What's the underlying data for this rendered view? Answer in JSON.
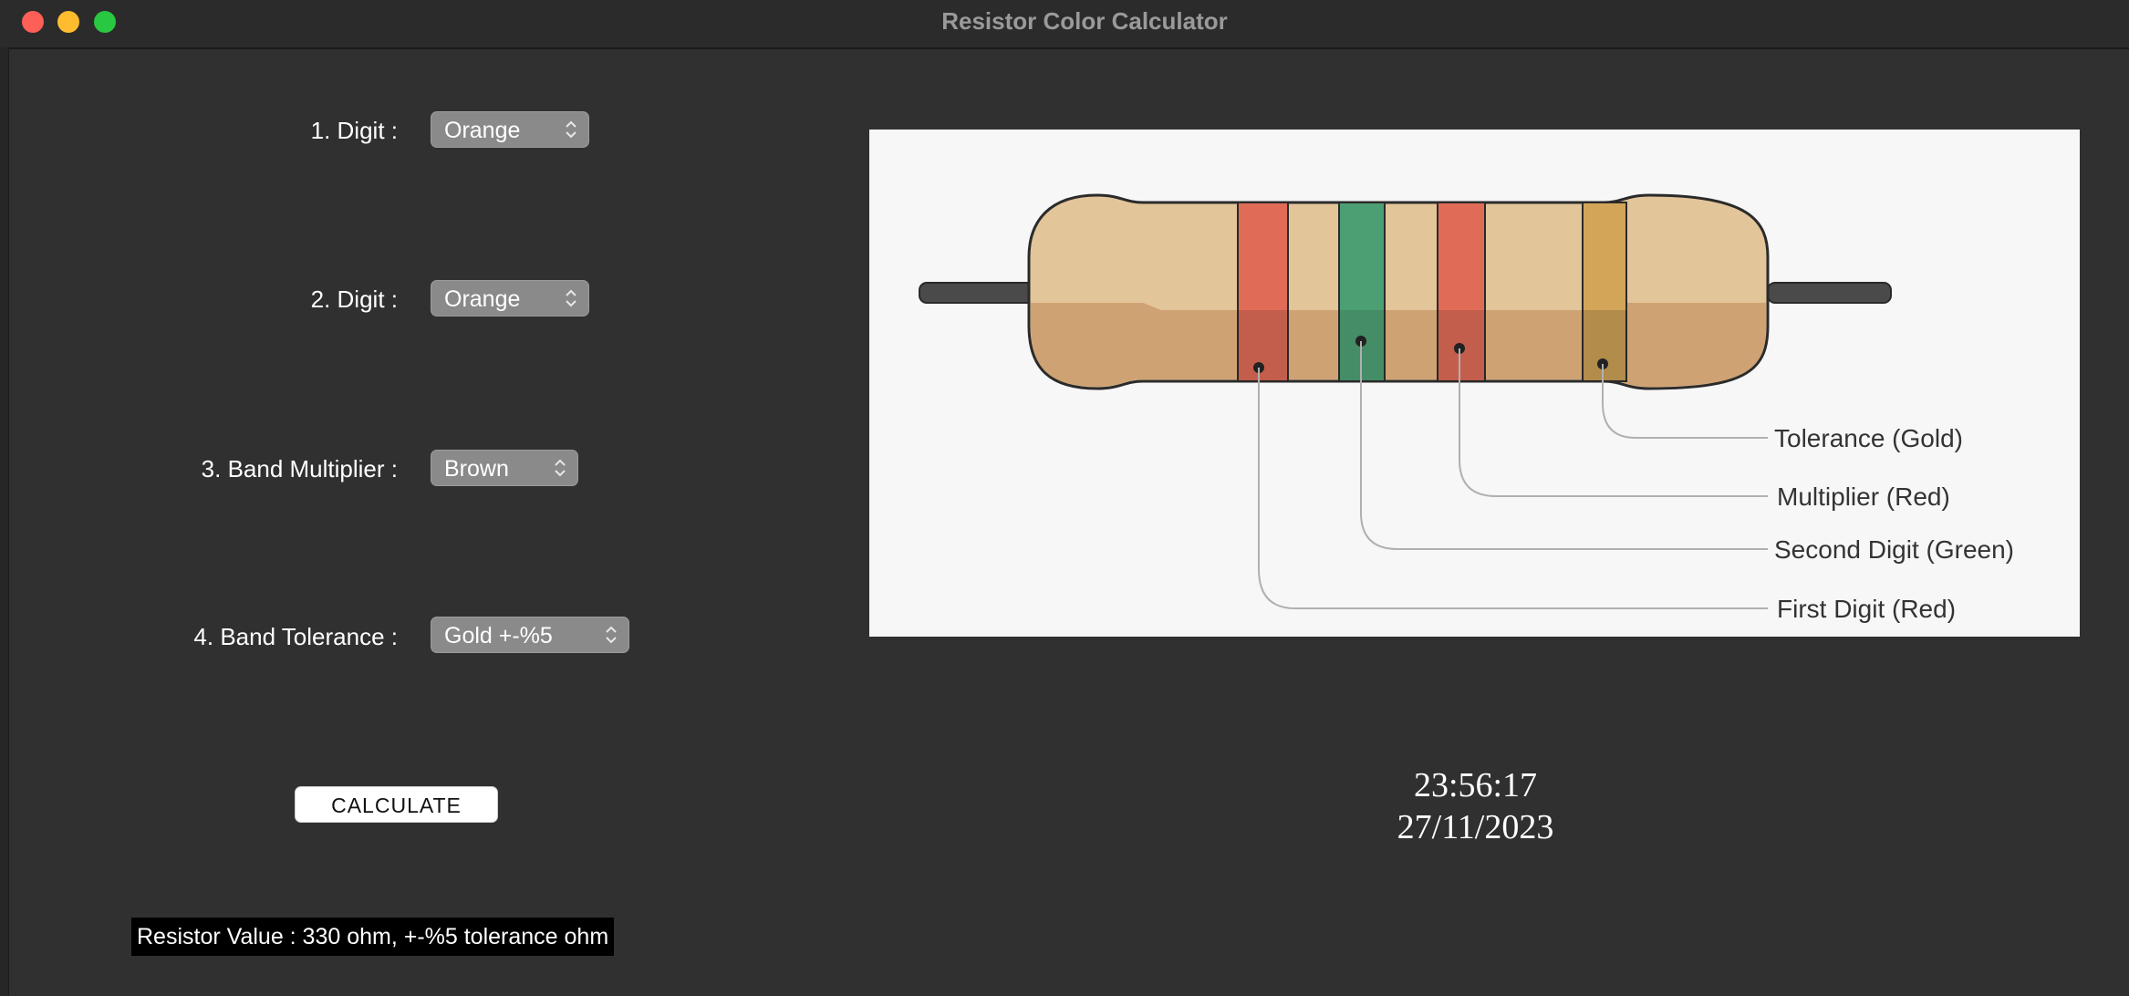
{
  "window": {
    "title": "Resistor Color Calculator"
  },
  "form": {
    "digit1": {
      "label": "1. Digit :",
      "value": "Orange"
    },
    "digit2": {
      "label": "2. Digit :",
      "value": "Orange"
    },
    "multiplier": {
      "label": "3. Band Multiplier :",
      "value": "Brown"
    },
    "tolerance": {
      "label": "4. Band Tolerance :",
      "value": "Gold +-%5"
    },
    "calculate_label": "CALCULATE",
    "result_text": "Resistor Value : 330 ohm, +-%5 tolerance ohm"
  },
  "diagram": {
    "labels": {
      "tolerance": "Tolerance (Gold)",
      "multiplier": "Multiplier (Red)",
      "second_digit": "Second Digit (Green)",
      "first_digit": "First Digit (Red)"
    },
    "colors": {
      "body": "#e3c59a",
      "band_red": "#e06b57",
      "band_green": "#4c9e73",
      "band_gold": "#d2a559",
      "lead": "#555555"
    }
  },
  "clock": {
    "time": "23:56:17",
    "date": "27/11/2023"
  },
  "icons": {
    "close": "close-icon",
    "minimize": "minimize-icon",
    "zoom": "zoom-icon",
    "chevron": "updown-chevron-icon"
  }
}
